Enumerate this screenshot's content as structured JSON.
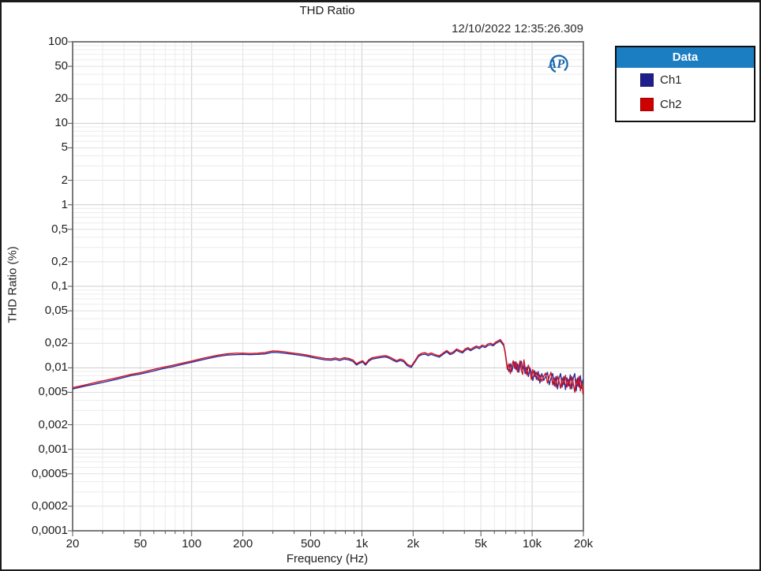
{
  "header": {
    "title": "THD Ratio",
    "timestamp": "12/10/2022 12:35:26.309"
  },
  "logo": {
    "name": "AP",
    "color": "#1767ad"
  },
  "legend": {
    "title": "Data",
    "header_color": "#1b7ec2",
    "items": [
      {
        "label": "Ch1",
        "color": "#1f1f8b"
      },
      {
        "label": "Ch2",
        "color": "#d10000"
      }
    ]
  },
  "colors": {
    "grid_minor": "#ececec",
    "grid_mid": "#e1e1e1",
    "grid_major": "#cdcdcd",
    "frame": "#7a7a7a",
    "tick": "#555555"
  },
  "chart_data": {
    "type": "line",
    "title": "THD Ratio",
    "xlabel": "Frequency (Hz)",
    "ylabel": "THD Ratio (%)",
    "xscale": "log",
    "yscale": "log",
    "xlim": [
      20,
      20000
    ],
    "ylim": [
      0.0001,
      100
    ],
    "grid": true,
    "legend_position": "right",
    "x_ticks": [
      {
        "v": 20,
        "label": "20"
      },
      {
        "v": 50,
        "label": "50"
      },
      {
        "v": 100,
        "label": "100"
      },
      {
        "v": 200,
        "label": "200"
      },
      {
        "v": 500,
        "label": "500"
      },
      {
        "v": 1000,
        "label": "1k"
      },
      {
        "v": 2000,
        "label": "2k"
      },
      {
        "v": 5000,
        "label": "5k"
      },
      {
        "v": 10000,
        "label": "10k"
      },
      {
        "v": 20000,
        "label": "20k"
      }
    ],
    "y_ticks": [
      {
        "v": 100,
        "label": "100"
      },
      {
        "v": 50,
        "label": "50"
      },
      {
        "v": 20,
        "label": "20"
      },
      {
        "v": 10,
        "label": "10"
      },
      {
        "v": 5,
        "label": "5"
      },
      {
        "v": 2,
        "label": "2"
      },
      {
        "v": 1,
        "label": "1"
      },
      {
        "v": 0.5,
        "label": "0,5"
      },
      {
        "v": 0.2,
        "label": "0,2"
      },
      {
        "v": 0.1,
        "label": "0,1"
      },
      {
        "v": 0.05,
        "label": "0,05"
      },
      {
        "v": 0.02,
        "label": "0,02"
      },
      {
        "v": 0.01,
        "label": "0,01"
      },
      {
        "v": 0.005,
        "label": "0,005"
      },
      {
        "v": 0.002,
        "label": "0,002"
      },
      {
        "v": 0.001,
        "label": "0,001"
      },
      {
        "v": 0.0005,
        "label": "0,0005"
      },
      {
        "v": 0.0002,
        "label": "0,0002"
      },
      {
        "v": 0.0001,
        "label": "0,0001"
      }
    ],
    "series": [
      {
        "name": "Ch1",
        "color": "#2d2d9a",
        "points": [
          [
            20,
            0.0055
          ],
          [
            24,
            0.006
          ],
          [
            28,
            0.0064
          ],
          [
            33,
            0.0069
          ],
          [
            38,
            0.0074
          ],
          [
            44,
            0.008
          ],
          [
            50,
            0.0084
          ],
          [
            58,
            0.009
          ],
          [
            67,
            0.0097
          ],
          [
            77,
            0.0103
          ],
          [
            88,
            0.011
          ],
          [
            100,
            0.0117
          ],
          [
            113,
            0.0124
          ],
          [
            127,
            0.0131
          ],
          [
            143,
            0.0138
          ],
          [
            160,
            0.0143
          ],
          [
            180,
            0.0145
          ],
          [
            200,
            0.0146
          ],
          [
            220,
            0.0145
          ],
          [
            245,
            0.0146
          ],
          [
            270,
            0.0148
          ],
          [
            300,
            0.0155
          ],
          [
            320,
            0.0154
          ],
          [
            350,
            0.0151
          ],
          [
            390,
            0.0147
          ],
          [
            430,
            0.0143
          ],
          [
            470,
            0.0139
          ],
          [
            510,
            0.0134
          ],
          [
            560,
            0.0129
          ],
          [
            610,
            0.0125
          ],
          [
            660,
            0.0124
          ],
          [
            700,
            0.0127
          ],
          [
            740,
            0.0123
          ],
          [
            790,
            0.0128
          ],
          [
            840,
            0.0125
          ],
          [
            890,
            0.0119
          ],
          [
            930,
            0.0108
          ],
          [
            970,
            0.0114
          ],
          [
            1010,
            0.0118
          ],
          [
            1050,
            0.0108
          ],
          [
            1100,
            0.0121
          ],
          [
            1150,
            0.0128
          ],
          [
            1220,
            0.0131
          ],
          [
            1300,
            0.0134
          ],
          [
            1380,
            0.0136
          ],
          [
            1450,
            0.0131
          ],
          [
            1520,
            0.0124
          ],
          [
            1600,
            0.0118
          ],
          [
            1680,
            0.0123
          ],
          [
            1760,
            0.0119
          ],
          [
            1850,
            0.0106
          ],
          [
            1950,
            0.0101
          ],
          [
            2050,
            0.0118
          ],
          [
            2150,
            0.0138
          ],
          [
            2250,
            0.0145
          ],
          [
            2350,
            0.0147
          ],
          [
            2450,
            0.0141
          ],
          [
            2550,
            0.0146
          ],
          [
            2700,
            0.014
          ],
          [
            2850,
            0.0135
          ],
          [
            3000,
            0.0146
          ],
          [
            3150,
            0.0157
          ],
          [
            3300,
            0.0145
          ],
          [
            3450,
            0.0151
          ],
          [
            3600,
            0.0164
          ],
          [
            3750,
            0.0157
          ],
          [
            3900,
            0.0152
          ],
          [
            4050,
            0.0164
          ],
          [
            4200,
            0.017
          ],
          [
            4350,
            0.0162
          ],
          [
            4500,
            0.0169
          ],
          [
            4700,
            0.0178
          ],
          [
            4900,
            0.0172
          ],
          [
            5100,
            0.0183
          ],
          [
            5300,
            0.0177
          ],
          [
            5500,
            0.0188
          ],
          [
            5700,
            0.0192
          ],
          [
            5900,
            0.0186
          ],
          [
            6100,
            0.0198
          ],
          [
            6300,
            0.0206
          ],
          [
            6500,
            0.0213
          ],
          [
            6650,
            0.0199
          ],
          [
            6800,
            0.0188
          ],
          [
            6950,
            0.0155
          ],
          [
            7050,
            0.0125
          ],
          [
            7150,
            0.0102
          ],
          [
            7300,
            0.009
          ],
          [
            7450,
            0.0112
          ],
          [
            7600,
            0.009
          ],
          [
            7750,
            0.0108
          ],
          [
            7900,
            0.0118
          ],
          [
            8050,
            0.0095
          ],
          [
            8200,
            0.0112
          ],
          [
            8350,
            0.0088
          ],
          [
            8500,
            0.0108
          ],
          [
            8650,
            0.012
          ],
          [
            8800,
            0.0095
          ],
          [
            8950,
            0.0105
          ],
          [
            9100,
            0.0085
          ],
          [
            9300,
            0.0102
          ],
          [
            9500,
            0.0078
          ],
          [
            9700,
            0.01
          ],
          [
            9900,
            0.0088
          ],
          [
            10100,
            0.007
          ],
          [
            10350,
            0.0092
          ],
          [
            10600,
            0.0072
          ],
          [
            10850,
            0.009
          ],
          [
            11100,
            0.0065
          ],
          [
            11400,
            0.0085
          ],
          [
            11700,
            0.007
          ],
          [
            12000,
            0.0078
          ],
          [
            12300,
            0.0088
          ],
          [
            12600,
            0.0062
          ],
          [
            12900,
            0.0074
          ],
          [
            13200,
            0.0085
          ],
          [
            13500,
            0.006
          ],
          [
            13800,
            0.0078
          ],
          [
            14100,
            0.0055
          ],
          [
            14400,
            0.0075
          ],
          [
            14700,
            0.0085
          ],
          [
            15000,
            0.0058
          ],
          [
            15350,
            0.0078
          ],
          [
            15700,
            0.0054
          ],
          [
            16050,
            0.0075
          ],
          [
            16400,
            0.006
          ],
          [
            16750,
            0.0082
          ],
          [
            17100,
            0.0055
          ],
          [
            17450,
            0.0075
          ],
          [
            17800,
            0.0085
          ],
          [
            18150,
            0.0052
          ],
          [
            18500,
            0.0075
          ],
          [
            18850,
            0.0058
          ],
          [
            19200,
            0.008
          ],
          [
            19550,
            0.0056
          ],
          [
            19900,
            0.0072
          ]
        ]
      },
      {
        "name": "Ch2",
        "color": "#cf1020",
        "points": [
          [
            20,
            0.0057
          ],
          [
            24,
            0.0062
          ],
          [
            28,
            0.0067
          ],
          [
            33,
            0.0072
          ],
          [
            38,
            0.0077
          ],
          [
            44,
            0.0083
          ],
          [
            50,
            0.0087
          ],
          [
            58,
            0.0094
          ],
          [
            67,
            0.0101
          ],
          [
            77,
            0.0107
          ],
          [
            88,
            0.0114
          ],
          [
            100,
            0.0121
          ],
          [
            113,
            0.0129
          ],
          [
            127,
            0.0136
          ],
          [
            143,
            0.0143
          ],
          [
            160,
            0.0148
          ],
          [
            180,
            0.0151
          ],
          [
            200,
            0.0151
          ],
          [
            220,
            0.015
          ],
          [
            245,
            0.0151
          ],
          [
            270,
            0.0154
          ],
          [
            300,
            0.0161
          ],
          [
            320,
            0.016
          ],
          [
            350,
            0.0157
          ],
          [
            390,
            0.0152
          ],
          [
            430,
            0.0148
          ],
          [
            470,
            0.0144
          ],
          [
            510,
            0.0139
          ],
          [
            560,
            0.0134
          ],
          [
            610,
            0.013
          ],
          [
            660,
            0.0129
          ],
          [
            700,
            0.0132
          ],
          [
            740,
            0.0128
          ],
          [
            790,
            0.0133
          ],
          [
            840,
            0.013
          ],
          [
            890,
            0.0124
          ],
          [
            930,
            0.0112
          ],
          [
            970,
            0.0118
          ],
          [
            1010,
            0.0122
          ],
          [
            1050,
            0.0112
          ],
          [
            1100,
            0.0126
          ],
          [
            1150,
            0.0133
          ],
          [
            1220,
            0.0136
          ],
          [
            1300,
            0.0139
          ],
          [
            1380,
            0.0141
          ],
          [
            1450,
            0.0136
          ],
          [
            1520,
            0.0129
          ],
          [
            1600,
            0.0122
          ],
          [
            1680,
            0.0128
          ],
          [
            1760,
            0.0124
          ],
          [
            1850,
            0.011
          ],
          [
            1950,
            0.0105
          ],
          [
            2050,
            0.0122
          ],
          [
            2150,
            0.0143
          ],
          [
            2250,
            0.0151
          ],
          [
            2350,
            0.0153
          ],
          [
            2450,
            0.0147
          ],
          [
            2550,
            0.0152
          ],
          [
            2700,
            0.0145
          ],
          [
            2850,
            0.014
          ],
          [
            3000,
            0.0152
          ],
          [
            3150,
            0.0163
          ],
          [
            3300,
            0.0151
          ],
          [
            3450,
            0.0157
          ],
          [
            3600,
            0.017
          ],
          [
            3750,
            0.0163
          ],
          [
            3900,
            0.0158
          ],
          [
            4050,
            0.0171
          ],
          [
            4200,
            0.0177
          ],
          [
            4350,
            0.0168
          ],
          [
            4500,
            0.0176
          ],
          [
            4700,
            0.0185
          ],
          [
            4900,
            0.0179
          ],
          [
            5100,
            0.019
          ],
          [
            5300,
            0.0184
          ],
          [
            5500,
            0.0196
          ],
          [
            5700,
            0.02
          ],
          [
            5900,
            0.0193
          ],
          [
            6100,
            0.0206
          ],
          [
            6300,
            0.0214
          ],
          [
            6500,
            0.0222
          ],
          [
            6650,
            0.0207
          ],
          [
            6800,
            0.0196
          ],
          [
            6950,
            0.015
          ],
          [
            7050,
            0.012
          ],
          [
            7150,
            0.0096
          ],
          [
            7300,
            0.0112
          ],
          [
            7450,
            0.0085
          ],
          [
            7600,
            0.0108
          ],
          [
            7750,
            0.0122
          ],
          [
            7900,
            0.0098
          ],
          [
            8050,
            0.0118
          ],
          [
            8200,
            0.0089
          ],
          [
            8350,
            0.0105
          ],
          [
            8500,
            0.0122
          ],
          [
            8650,
            0.0092
          ],
          [
            8800,
            0.0083
          ],
          [
            8950,
            0.0125
          ],
          [
            9100,
            0.01
          ],
          [
            9300,
            0.0082
          ],
          [
            9500,
            0.0108
          ],
          [
            9700,
            0.0092
          ],
          [
            9900,
            0.0072
          ],
          [
            10100,
            0.0095
          ],
          [
            10350,
            0.0078
          ],
          [
            10600,
            0.0088
          ],
          [
            10850,
            0.007
          ],
          [
            11100,
            0.0082
          ],
          [
            11400,
            0.0068
          ],
          [
            11700,
            0.0079
          ],
          [
            12000,
            0.0086
          ],
          [
            12300,
            0.0065
          ],
          [
            12600,
            0.0077
          ],
          [
            12900,
            0.0088
          ],
          [
            13200,
            0.0062
          ],
          [
            13500,
            0.0075
          ],
          [
            13800,
            0.0058
          ],
          [
            14100,
            0.0079
          ],
          [
            14400,
            0.0068
          ],
          [
            14700,
            0.0056
          ],
          [
            15000,
            0.0075
          ],
          [
            15350,
            0.0062
          ],
          [
            15700,
            0.0081
          ],
          [
            16050,
            0.0058
          ],
          [
            16400,
            0.0072
          ],
          [
            16750,
            0.0055
          ],
          [
            17100,
            0.0078
          ],
          [
            17450,
            0.0064
          ],
          [
            17800,
            0.005
          ],
          [
            18150,
            0.0072
          ],
          [
            18500,
            0.006
          ],
          [
            18850,
            0.0078
          ],
          [
            19200,
            0.0052
          ],
          [
            19550,
            0.0068
          ],
          [
            19900,
            0.0047
          ]
        ]
      }
    ]
  }
}
